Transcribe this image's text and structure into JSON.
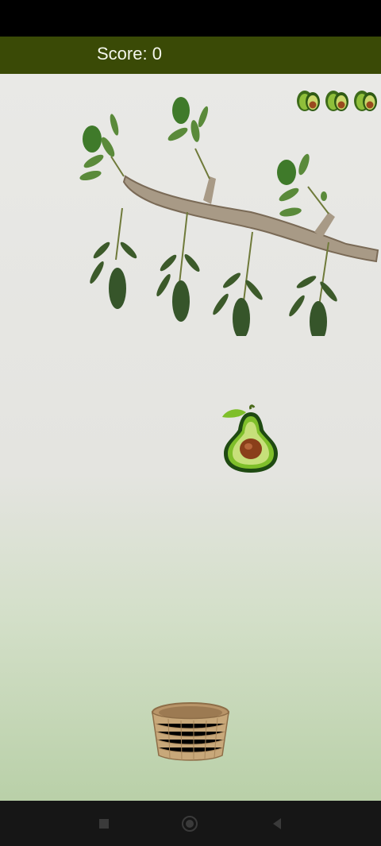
{
  "header": {
    "score_text": "Score: 0"
  },
  "game": {
    "score": 0,
    "lives_remaining": 3,
    "icons": {
      "life": "avocado-half-icon",
      "falling_item": "avocado-half-icon",
      "catcher": "basket-icon",
      "scenery": "avocado-branch"
    }
  },
  "system_nav": {
    "buttons": [
      "recent-apps",
      "home",
      "back"
    ]
  },
  "colors": {
    "header_background": "#3a4a06",
    "score_text": "#f4f6ec",
    "avocado_skin": "#1f4a12",
    "avocado_flesh": "#7fbf2a",
    "avocado_pit": "#8a3f1a",
    "basket": "#c8a87a"
  }
}
